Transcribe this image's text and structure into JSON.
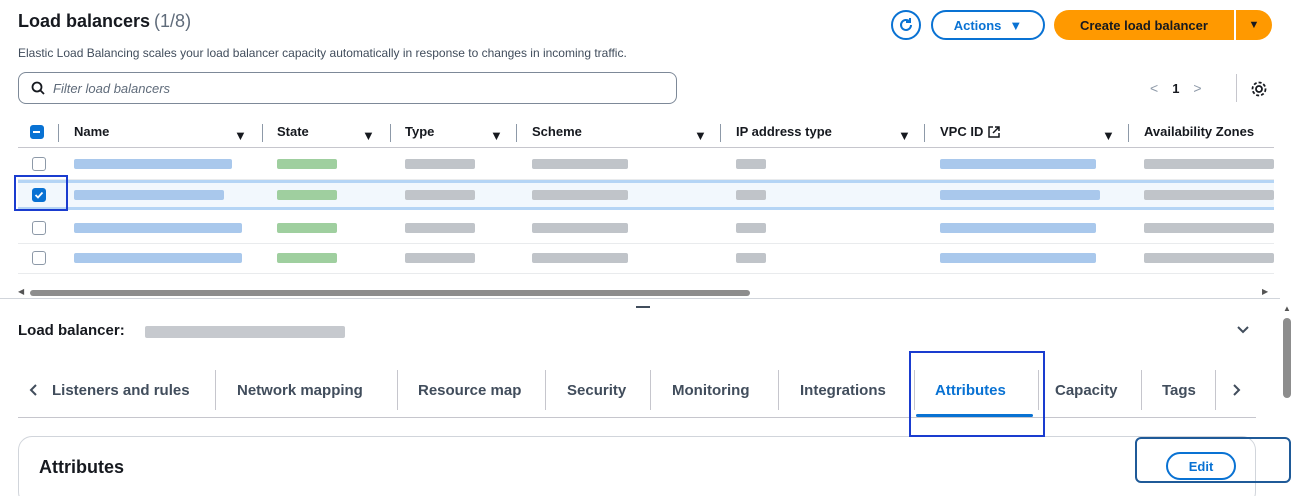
{
  "header": {
    "title": "Load balancers",
    "count": "(1/8)",
    "subtitle": "Elastic Load Balancing scales your load balancer capacity automatically in response to changes in incoming traffic.",
    "actions_label": "Actions",
    "create_label": "Create load balancer"
  },
  "filter": {
    "placeholder": "Filter load balancers"
  },
  "pagination": {
    "page": "1"
  },
  "table": {
    "columns": [
      "Name",
      "State",
      "Type",
      "Scheme",
      "IP address type",
      "VPC ID",
      "Availability Zones"
    ]
  },
  "detail": {
    "title": "Load balancer:",
    "tabs": [
      "Listeners and rules",
      "Network mapping",
      "Resource map",
      "Security",
      "Monitoring",
      "Integrations",
      "Attributes",
      "Capacity",
      "Tags"
    ],
    "active_tab": "Attributes",
    "section_title": "Attributes",
    "edit_label": "Edit"
  },
  "colors": {
    "accent": "#0972d3",
    "primary_button": "#ff9900",
    "highlight": "#1a3ccf"
  }
}
